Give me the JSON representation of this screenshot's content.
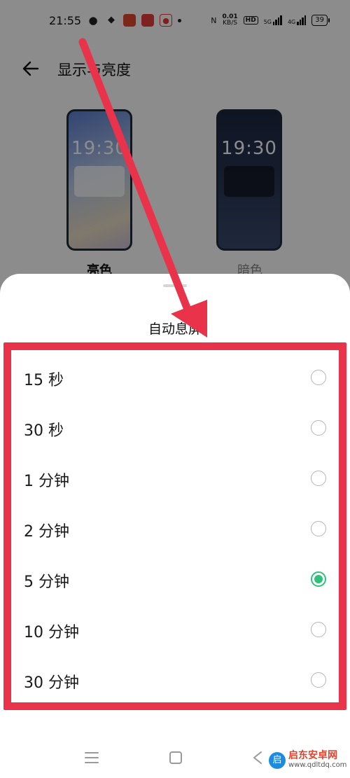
{
  "status_bar": {
    "time": "21:55",
    "net_speed_value": "0.01",
    "net_speed_unit": "KB/S",
    "hd_badge": "HD",
    "signal1_label": "5G",
    "signal2_label": "4G",
    "battery": "39"
  },
  "header": {
    "title": "显示与亮度"
  },
  "preview": {
    "light_time": "19:30",
    "dark_time": "19:30",
    "light_label": "亮色",
    "dark_label": "暗色"
  },
  "sheet": {
    "title": "自动息屏",
    "options": [
      {
        "label": "15 秒",
        "selected": false
      },
      {
        "label": "30 秒",
        "selected": false
      },
      {
        "label": "1 分钟",
        "selected": false
      },
      {
        "label": "2 分钟",
        "selected": false
      },
      {
        "label": "5 分钟",
        "selected": true
      },
      {
        "label": "10 分钟",
        "selected": false
      },
      {
        "label": "30 分钟",
        "selected": false
      }
    ]
  },
  "watermark": {
    "name": "启东安卓网",
    "url": "www.qdltdq.com"
  },
  "colors": {
    "accent": "#2fc27a",
    "annotation": "#e8334a"
  }
}
